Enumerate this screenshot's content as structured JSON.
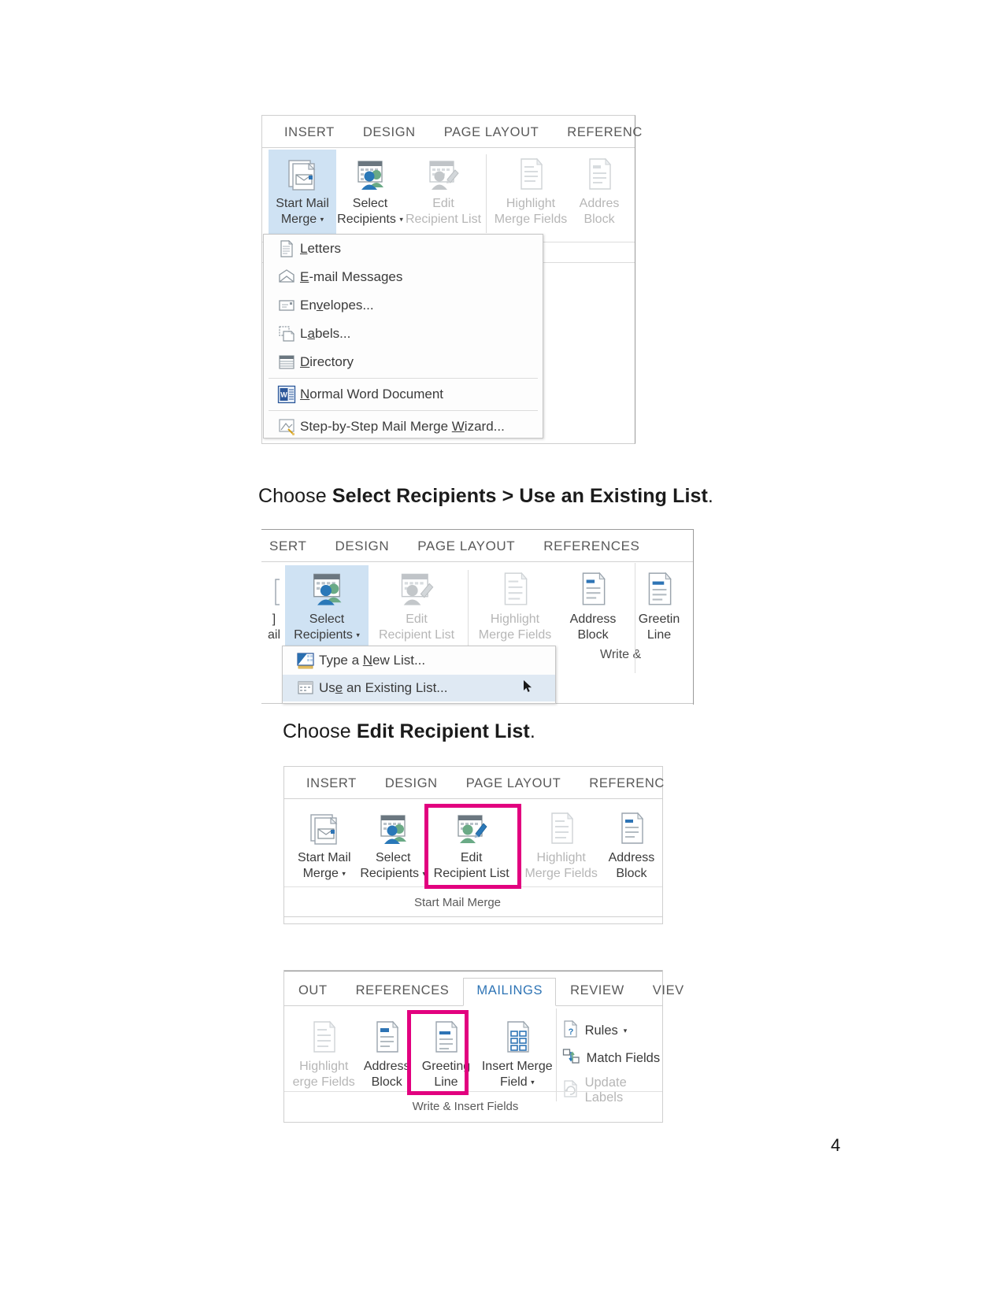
{
  "page": {
    "number": "4"
  },
  "figure1": {
    "name": "start-mail-merge-dropdown-figure",
    "tabs": [
      "INSERT",
      "DESIGN",
      "PAGE LAYOUT",
      "REFERENC"
    ],
    "buttons": [
      {
        "id": "start-mail-merge",
        "line1": "Start Mail",
        "line2": "Merge",
        "caret": true,
        "state": "selected"
      },
      {
        "id": "select-recipients",
        "line1": "Select",
        "line2": "Recipients",
        "caret": true,
        "state": "normal"
      },
      {
        "id": "edit-recipient-list",
        "line1": "Edit",
        "line2": "Recipient List",
        "caret": false,
        "state": "disabled"
      },
      {
        "id": "highlight-merge-fields",
        "line1": "Highlight",
        "line2": "Merge Fields",
        "caret": false,
        "state": "disabled"
      },
      {
        "id": "address-block",
        "line1": "Addres",
        "line2": "Block",
        "caret": false,
        "state": "disabled"
      }
    ],
    "menu": {
      "items": [
        {
          "id": "letters",
          "pre": "L",
          "accel": "",
          "post": "etters",
          "icon": "document-icon"
        },
        {
          "id": "email-messages",
          "pre": "",
          "accel": "E",
          "post": "-mail Messages",
          "icon": "envelope-icon"
        },
        {
          "id": "envelopes",
          "pre": "En",
          "accel": "v",
          "post": "elopes...",
          "icon": "envelope-small-icon"
        },
        {
          "id": "labels",
          "pre": "L",
          "accel": "a",
          "post": "bels...",
          "icon": "labels-icon"
        },
        {
          "id": "directory",
          "pre": "",
          "accel": "D",
          "post": "irectory",
          "icon": "directory-icon"
        },
        {
          "id": "normal-word-document",
          "pre": "",
          "accel": "N",
          "post": "ormal Word Document",
          "icon": "word-document-icon",
          "separator_before": true
        },
        {
          "id": "step-by-step-wizard",
          "pre": "Step-by-Step Mail Merge ",
          "accel": "W",
          "post": "izard...",
          "icon": "wizard-icon",
          "separator_before": true
        }
      ]
    }
  },
  "caption1": {
    "lead": "Choose ",
    "bold1": "Select Recipients",
    "mid": " > ",
    "bold2": "Use an Existing List",
    "tail": "."
  },
  "figure2": {
    "name": "select-recipients-dropdown-figure",
    "tabs": [
      "SERT",
      "DESIGN",
      "PAGE LAYOUT",
      "REFERENCES"
    ],
    "buttons": [
      {
        "id": "start-mail-merge",
        "line1": "]",
        "line2": "ail",
        "caret": true,
        "state": "clipped"
      },
      {
        "id": "select-recipients",
        "line1": "Select",
        "line2": "Recipients",
        "caret": true,
        "state": "selected"
      },
      {
        "id": "edit-recipient-list",
        "line1": "Edit",
        "line2": "Recipient List",
        "caret": false,
        "state": "disabled"
      },
      {
        "id": "highlight-merge-fields",
        "line1": "Highlight",
        "line2": "Merge Fields",
        "caret": false,
        "state": "disabled"
      },
      {
        "id": "address-block",
        "line1": "Address",
        "line2": "Block",
        "caret": false,
        "state": "normal"
      },
      {
        "id": "greeting-line",
        "line1": "Greetin",
        "line2": "Line",
        "caret": false,
        "state": "normal"
      }
    ],
    "group_label_right": "Write &",
    "menu": {
      "items": [
        {
          "id": "type-a-new-list",
          "pre": "Type a ",
          "accel": "N",
          "post": "ew List...",
          "icon": "new-list-icon",
          "highlighted": false
        },
        {
          "id": "use-an-existing-list",
          "pre": "Us",
          "accel": "e",
          "post": " an Existing List...",
          "icon": "existing-list-icon",
          "highlighted": true
        }
      ]
    }
  },
  "caption2": {
    "lead": "Choose ",
    "bold": "Edit Recipient List",
    "tail": "."
  },
  "figure3": {
    "name": "edit-recipient-list-highlight-figure",
    "tabs": [
      "INSERT",
      "DESIGN",
      "PAGE LAYOUT",
      "REFERENC"
    ],
    "buttons": [
      {
        "id": "start-mail-merge",
        "line1": "Start Mail",
        "line2": "Merge",
        "caret": true,
        "state": "normal"
      },
      {
        "id": "select-recipients",
        "line1": "Select",
        "line2": "Recipients",
        "caret": true,
        "state": "normal"
      },
      {
        "id": "edit-recipient-list",
        "line1": "Edit",
        "line2": "Recipient List",
        "caret": false,
        "state": "highlighted"
      },
      {
        "id": "highlight-merge-fields",
        "line1": "Highlight",
        "line2": "Merge Fields",
        "caret": false,
        "state": "disabled"
      },
      {
        "id": "address-block",
        "line1": "Address",
        "line2": "Block",
        "caret": false,
        "state": "normal"
      }
    ],
    "group_label": "Start Mail Merge"
  },
  "figure4": {
    "name": "greeting-line-highlight-figure",
    "tabs": [
      {
        "label": "OUT",
        "active": false
      },
      {
        "label": "REFERENCES",
        "active": false
      },
      {
        "label": "MAILINGS",
        "active": true
      },
      {
        "label": "REVIEW",
        "active": false
      },
      {
        "label": "VIEV",
        "active": false
      }
    ],
    "buttons": [
      {
        "id": "highlight-merge-fields",
        "line1": "Highlight",
        "line2": "erge Fields",
        "caret": false,
        "state": "disabled"
      },
      {
        "id": "address-block",
        "line1": "Address",
        "line2": "Block",
        "caret": false,
        "state": "normal"
      },
      {
        "id": "greeting-line",
        "line1": "Greeting",
        "line2": "Line",
        "caret": false,
        "state": "highlighted"
      },
      {
        "id": "insert-merge-field",
        "line1": "Insert Merge",
        "line2": "Field",
        "caret": true,
        "state": "normal"
      }
    ],
    "small_commands": [
      {
        "id": "rules",
        "label": "Rules",
        "caret": true,
        "state": "normal",
        "icon": "rules-icon"
      },
      {
        "id": "match-fields",
        "label": "Match Fields",
        "caret": false,
        "state": "normal",
        "icon": "match-fields-icon"
      },
      {
        "id": "update-labels",
        "label": "Update Labels",
        "caret": false,
        "state": "disabled",
        "icon": "update-labels-icon"
      }
    ],
    "group_label": "Write & Insert Fields"
  },
  "colors": {
    "accent_pink": "#e2007f",
    "selected_blue": "#cfe2f3",
    "tab_active_text": "#2e74b5",
    "disabled_gray": "#b6b6b6"
  }
}
